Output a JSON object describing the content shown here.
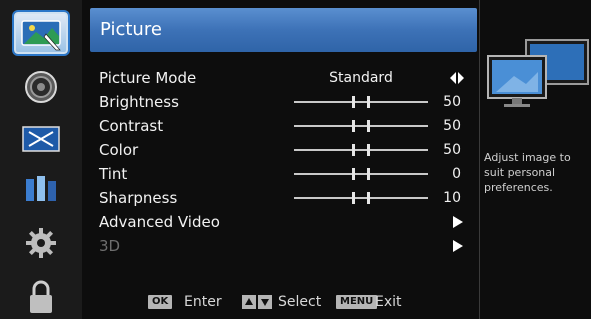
{
  "sidebar": {
    "items": [
      {
        "icon": "picture-icon",
        "active": true
      },
      {
        "icon": "speaker-icon",
        "active": false
      },
      {
        "icon": "screen-icon",
        "active": false
      },
      {
        "icon": "channel-icon",
        "active": false
      },
      {
        "icon": "gear-icon",
        "active": false
      },
      {
        "icon": "lock-icon",
        "active": false
      }
    ]
  },
  "menu": {
    "title": "Picture",
    "mode": {
      "label": "Picture Mode",
      "value": "Standard"
    },
    "sliders": [
      {
        "label": "Brightness",
        "value": "50",
        "level": 0.5
      },
      {
        "label": "Contrast",
        "value": "50",
        "level": 0.5
      },
      {
        "label": "Color",
        "value": "50",
        "level": 0.5
      },
      {
        "label": "Tint",
        "value": "0",
        "level": 0.5
      },
      {
        "label": "Sharpness",
        "value": "10",
        "level": 0.5
      }
    ],
    "advanced_video": {
      "label": "Advanced Video"
    },
    "three_d": {
      "label": "3D"
    }
  },
  "footer": {
    "ok_key": "OK",
    "enter_label": "Enter",
    "select_label": "Select",
    "menu_key": "MENU",
    "exit_label": "Exit"
  },
  "help_panel": {
    "description": "Adjust image to suit personal preferences."
  },
  "colors": {
    "header": "#3d72b7",
    "background": "#0d0d0d",
    "text": "#f2f2f2",
    "disabled_text": "#6e6e6e"
  }
}
